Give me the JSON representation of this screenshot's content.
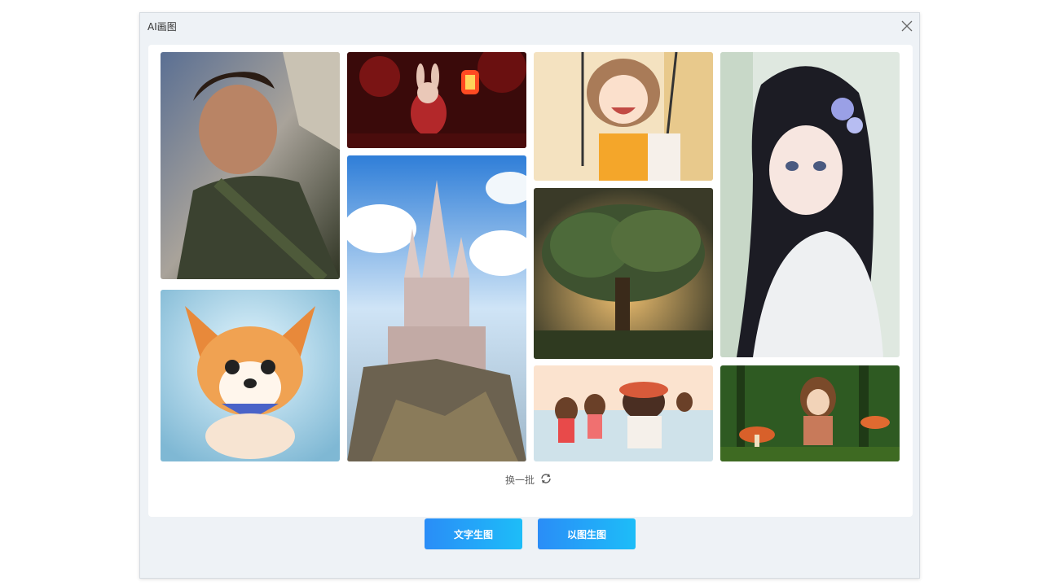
{
  "dialog": {
    "title": "AI画图",
    "close_icon": "close-icon"
  },
  "gallery": {
    "images": [
      {
        "name": "portrait-young-man",
        "desc": ""
      },
      {
        "name": "red-rabbit-lantern",
        "desc": ""
      },
      {
        "name": "girl-on-swing",
        "desc": ""
      },
      {
        "name": "anime-girl-flowers",
        "desc": ""
      },
      {
        "name": "fantasy-castle",
        "desc": ""
      },
      {
        "name": "glowing-tree",
        "desc": ""
      },
      {
        "name": "corgi-puppy",
        "desc": ""
      },
      {
        "name": "girls-on-beach",
        "desc": ""
      },
      {
        "name": "girl-in-forest-mushrooms",
        "desc": ""
      }
    ],
    "refresh_label": "换一批",
    "refresh_icon": "refresh-icon"
  },
  "actions": {
    "text_to_image_label": "文字生图",
    "image_to_image_label": "以图生图"
  },
  "colors": {
    "primary_gradient_start": "#2a8df7",
    "primary_gradient_end": "#1dbdf8",
    "dialog_bg": "#eef2f6",
    "panel_bg": "#ffffff"
  }
}
